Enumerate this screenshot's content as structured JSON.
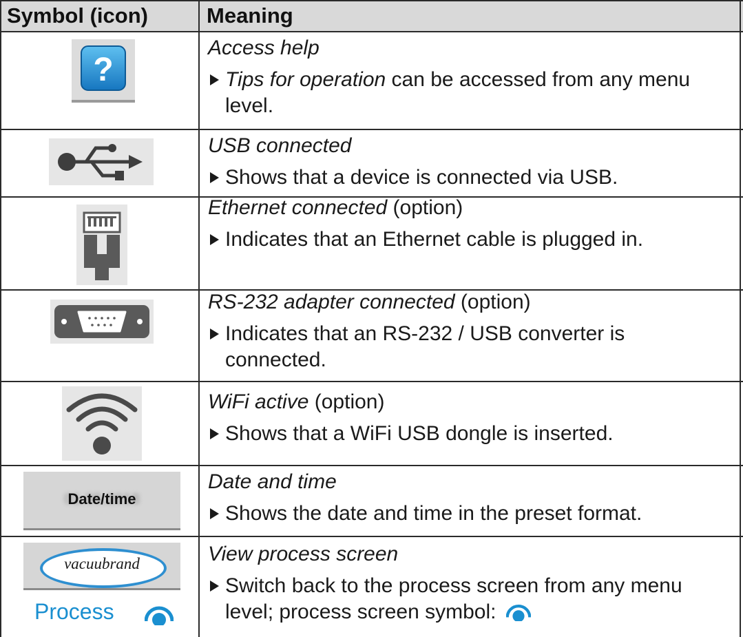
{
  "table": {
    "headers": {
      "symbol": "Symbol (icon)",
      "meaning": "Meaning"
    },
    "rows": [
      {
        "icon": "help-question-icon",
        "title": "Access help",
        "option": "",
        "desc_em": "Tips for operation",
        "desc": " can be accessed from any menu level."
      },
      {
        "icon": "usb-icon",
        "title": "USB connected",
        "option": "",
        "desc": "Shows that a device is connected via USB."
      },
      {
        "icon": "ethernet-icon",
        "title": "Ethernet connected",
        "option": " (option)",
        "desc": "Indicates that an Ethernet cable is plugged in."
      },
      {
        "icon": "rs232-connector-icon",
        "title": "RS-232 adapter connected",
        "option": " (option)",
        "desc": "Indicates that an RS-232 / USB converter is connected."
      },
      {
        "icon": "wifi-icon",
        "title": "WiFi active",
        "option": " (option)",
        "desc": "Shows that a WiFi USB dongle is inserted."
      },
      {
        "icon": "date-time-icon",
        "icon_label": "Date/time",
        "title": "Date and time",
        "option": "",
        "desc": "Shows the date and time in the preset format."
      },
      {
        "icon": "process-screen-icon",
        "icon_logo": "vacuubrand",
        "icon_label": "Process",
        "title": "View process screen",
        "option": "",
        "desc": "Switch back to the process screen from any menu level; process screen symbol:"
      }
    ]
  },
  "colors": {
    "header_bg": "#d9d9d9",
    "accent_blue": "#1a8fd0",
    "icon_gray": "#5a5a5a"
  }
}
